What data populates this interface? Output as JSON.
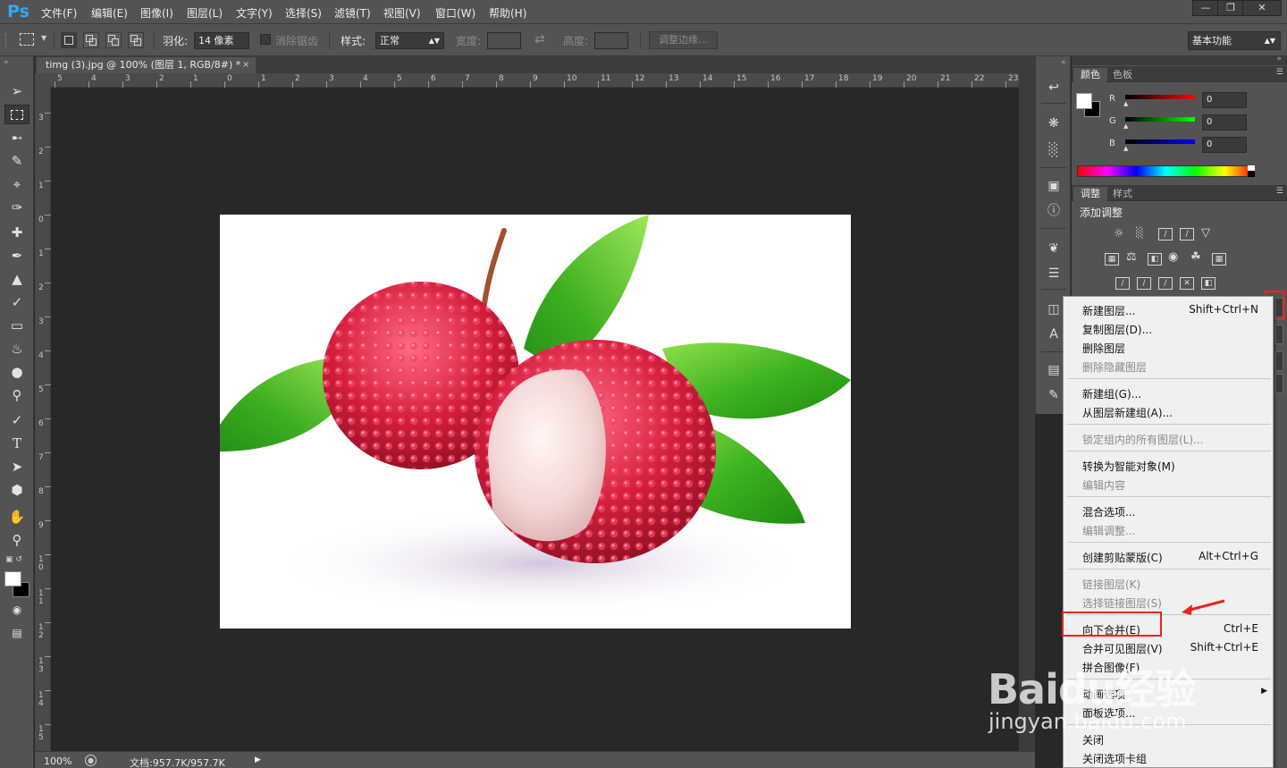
{
  "app": {
    "logo": "Ps",
    "menus": [
      "文件(F)",
      "编辑(E)",
      "图像(I)",
      "图层(L)",
      "文字(Y)",
      "选择(S)",
      "滤镜(T)",
      "视图(V)",
      "窗口(W)",
      "帮助(H)"
    ],
    "window_buttons": [
      "minimize",
      "restore",
      "close"
    ]
  },
  "options_bar": {
    "feather_label": "羽化:",
    "feather_value": "14 像素",
    "antialias_label": "消除锯齿",
    "style_label": "样式:",
    "style_value": "正常",
    "width_label": "宽度:",
    "height_label": "高度:",
    "refine_edge_label": "调整边缘...",
    "workspace": "基本功能"
  },
  "document": {
    "tab_title": "timg (3).jpg @ 100% (图层 1, RGB/8#) *",
    "ruler_top": [
      "5",
      "4",
      "3",
      "2",
      "1",
      "0",
      "1",
      "2",
      "3",
      "4",
      "5",
      "6",
      "7",
      "8",
      "9",
      "10",
      "11",
      "12",
      "13",
      "14",
      "15",
      "16",
      "17",
      "18",
      "19",
      "20",
      "21",
      "22",
      "23"
    ],
    "ruler_left": [
      "3",
      "2",
      "1",
      "0",
      "1",
      "2",
      "3",
      "4",
      "5",
      "6",
      "7",
      "8",
      "9",
      "10",
      "11",
      "12",
      "13",
      "14",
      "15"
    ],
    "zoom": "100%",
    "doc_info": "文档:957.7K/957.7K"
  },
  "tools": [
    "move-tool",
    "marquee-tool",
    "lasso-tool",
    "quick-select-tool",
    "crop-tool",
    "eyedropper-tool",
    "healing-tool",
    "brush-tool",
    "stamp-tool",
    "history-brush-tool",
    "eraser-tool",
    "paint-bucket-tool",
    "blur-tool",
    "dodge-tool",
    "pen-tool",
    "type-tool",
    "path-select-tool",
    "shape-tool",
    "hand-tool",
    "zoom-tool"
  ],
  "color_panel": {
    "tabs": [
      "颜色",
      "色板"
    ],
    "r_label": "R",
    "g_label": "G",
    "b_label": "B",
    "r_value": "0",
    "g_value": "0",
    "b_value": "0"
  },
  "adjust_panel": {
    "tabs": [
      "调整",
      "样式"
    ],
    "title": "添加调整"
  },
  "context_menu": {
    "items": [
      {
        "label": "新建图层...",
        "shortcut": "Shift+Ctrl+N",
        "disabled": false
      },
      {
        "label": "复制图层(D)...",
        "shortcut": "",
        "disabled": false
      },
      {
        "label": "删除图层",
        "shortcut": "",
        "disabled": false
      },
      {
        "label": "删除隐藏图层",
        "shortcut": "",
        "disabled": true
      },
      {
        "label": "新建组(G)...",
        "shortcut": "",
        "disabled": false
      },
      {
        "label": "从图层新建组(A)...",
        "shortcut": "",
        "disabled": false
      },
      {
        "label": "锁定组内的所有图层(L)...",
        "shortcut": "",
        "disabled": true
      },
      {
        "label": "转换为智能对象(M)",
        "shortcut": "",
        "disabled": false
      },
      {
        "label": "编辑内容",
        "shortcut": "",
        "disabled": true
      },
      {
        "label": "混合选项...",
        "shortcut": "",
        "disabled": false
      },
      {
        "label": "编辑调整...",
        "shortcut": "",
        "disabled": true
      },
      {
        "label": "创建剪贴蒙版(C)",
        "shortcut": "Alt+Ctrl+G",
        "disabled": false
      },
      {
        "label": "链接图层(K)",
        "shortcut": "",
        "disabled": true
      },
      {
        "label": "选择链接图层(S)",
        "shortcut": "",
        "disabled": true
      },
      {
        "label": "向下合并(E)",
        "shortcut": "Ctrl+E",
        "disabled": false
      },
      {
        "label": "合并可见图层(V)",
        "shortcut": "Shift+Ctrl+E",
        "disabled": false
      },
      {
        "label": "拼合图像(F)",
        "shortcut": "",
        "disabled": false
      },
      {
        "label": "动画选项",
        "shortcut": "",
        "disabled": false
      },
      {
        "label": "面板选项...",
        "shortcut": "",
        "disabled": false
      },
      {
        "label": "关闭",
        "shortcut": "",
        "disabled": false
      },
      {
        "label": "关闭选项卡组",
        "shortcut": "",
        "disabled": false
      }
    ]
  },
  "watermark": {
    "logo_text": "Baidu经验",
    "url": "jingyan.baidu.com"
  },
  "colors": {
    "accent_red": "#e8261a",
    "ps_blue": "#31a8ff"
  }
}
